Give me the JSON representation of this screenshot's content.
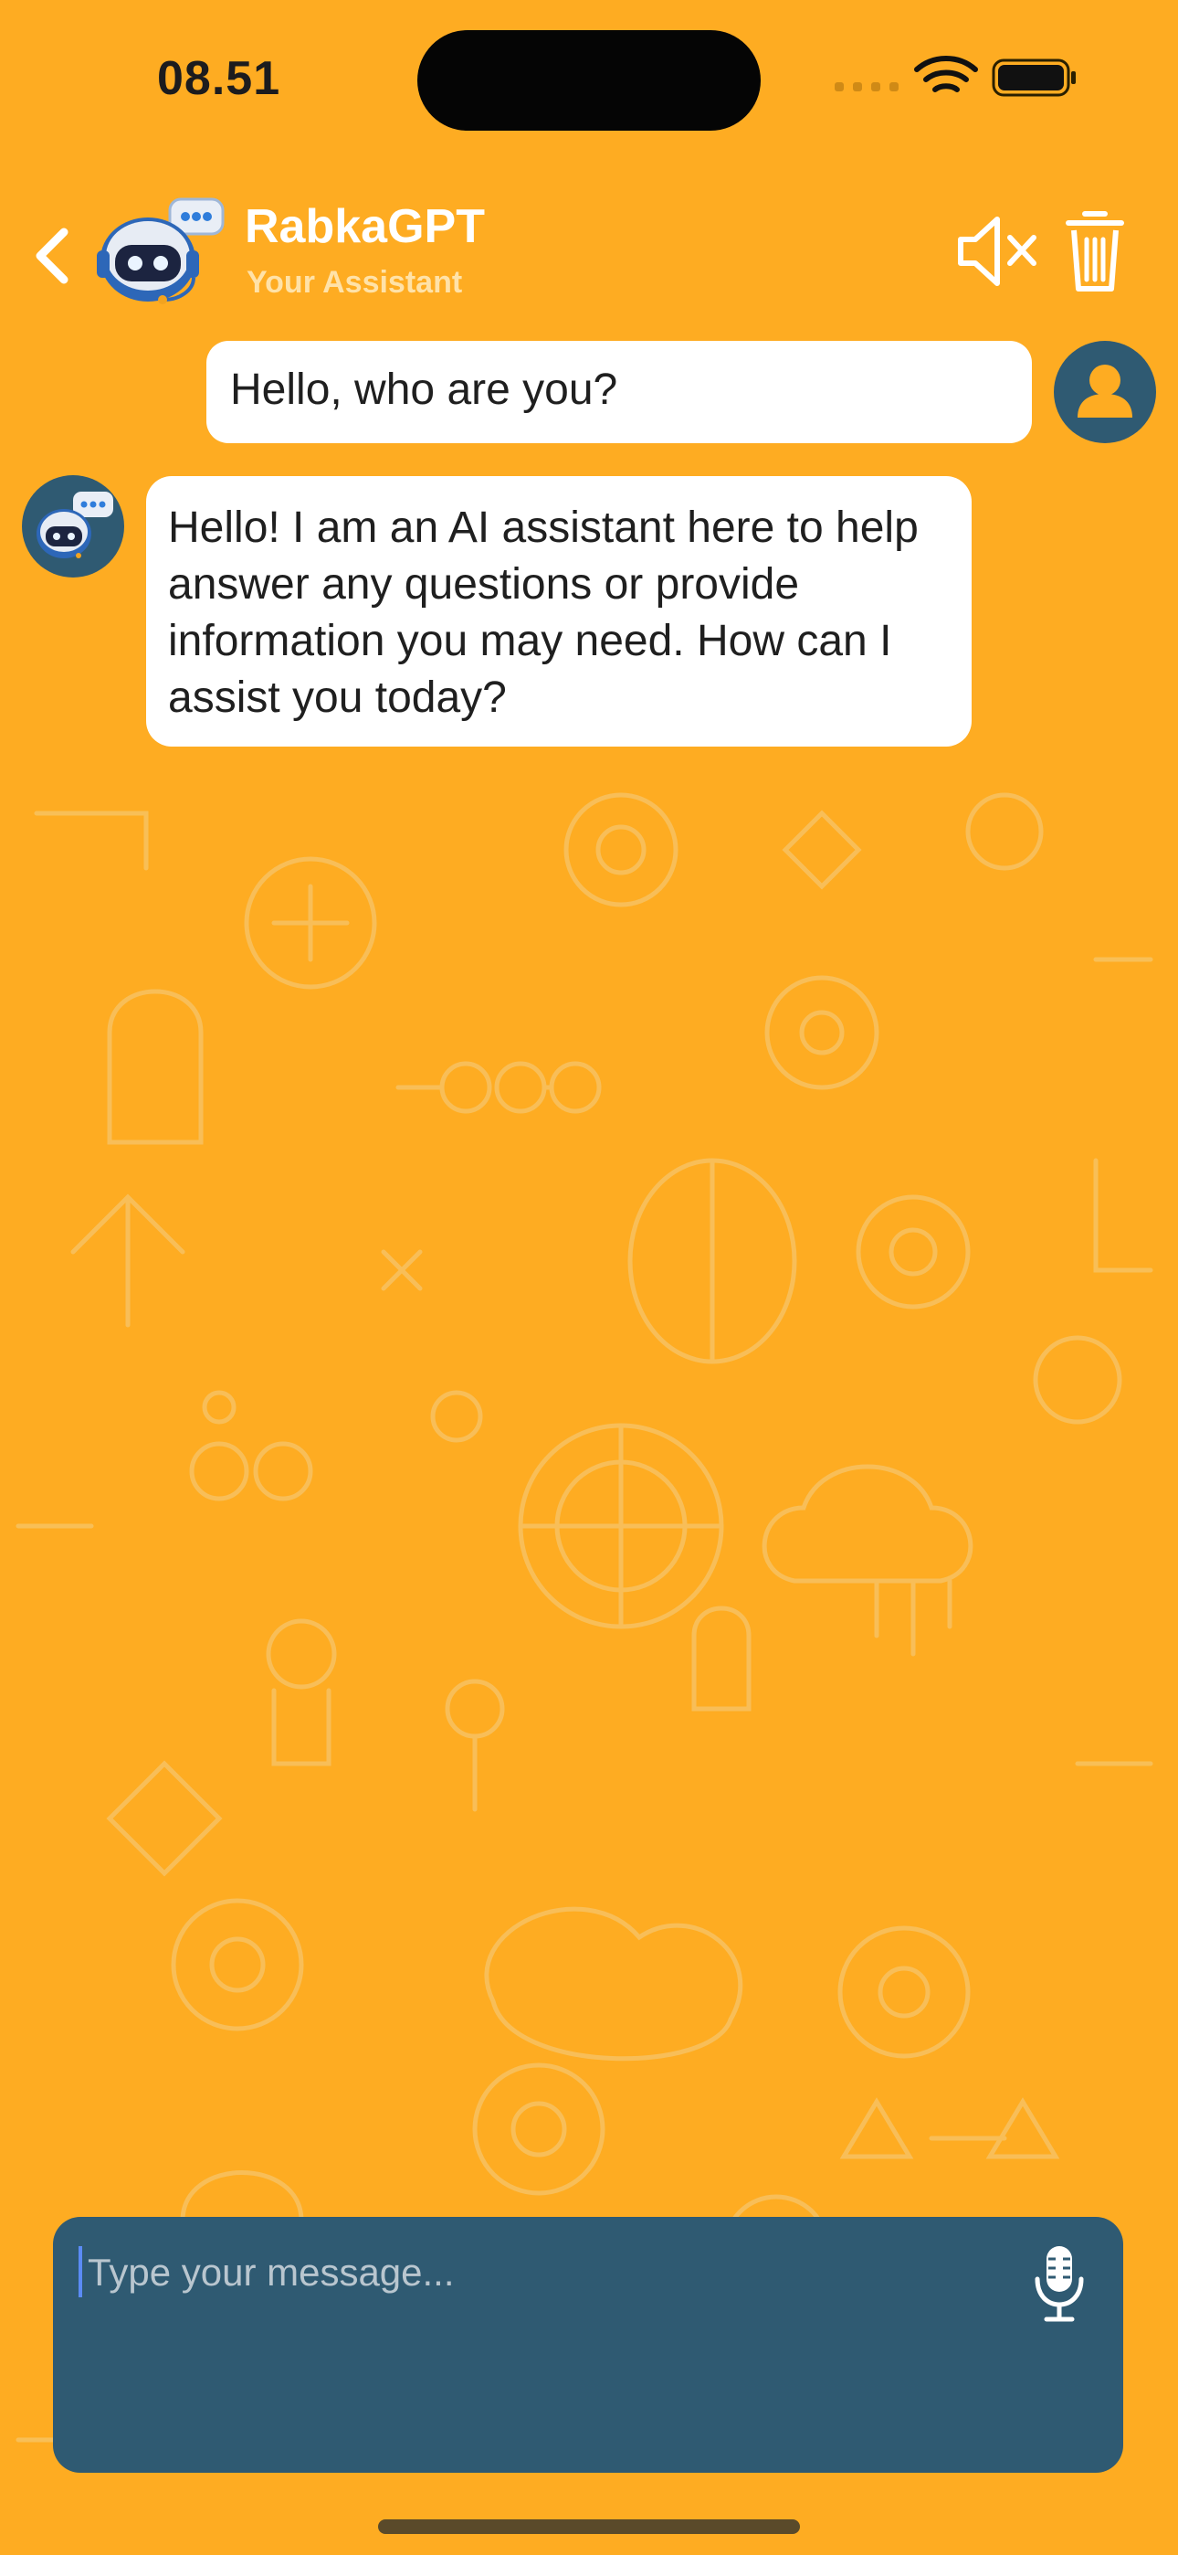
{
  "status_bar": {
    "time": "08.51"
  },
  "header": {
    "title": "RabkaGPT",
    "subtitle": "Your Assistant"
  },
  "messages": [
    {
      "role": "user",
      "text": "Hello, who are you?"
    },
    {
      "role": "assistant",
      "text": "Hello! I am an AI assistant here to help answer any questions or provide information you may need. How can I assist you today?"
    }
  ],
  "composer": {
    "placeholder": "Type your message..."
  },
  "icons": {
    "back": "chevron-left-icon",
    "mute": "speaker-muted-icon",
    "delete": "trash-icon",
    "mic": "microphone-icon"
  },
  "colors": {
    "background": "#FEAC22",
    "accent": "#2F5A72",
    "bubble": "#FFFFFF"
  }
}
